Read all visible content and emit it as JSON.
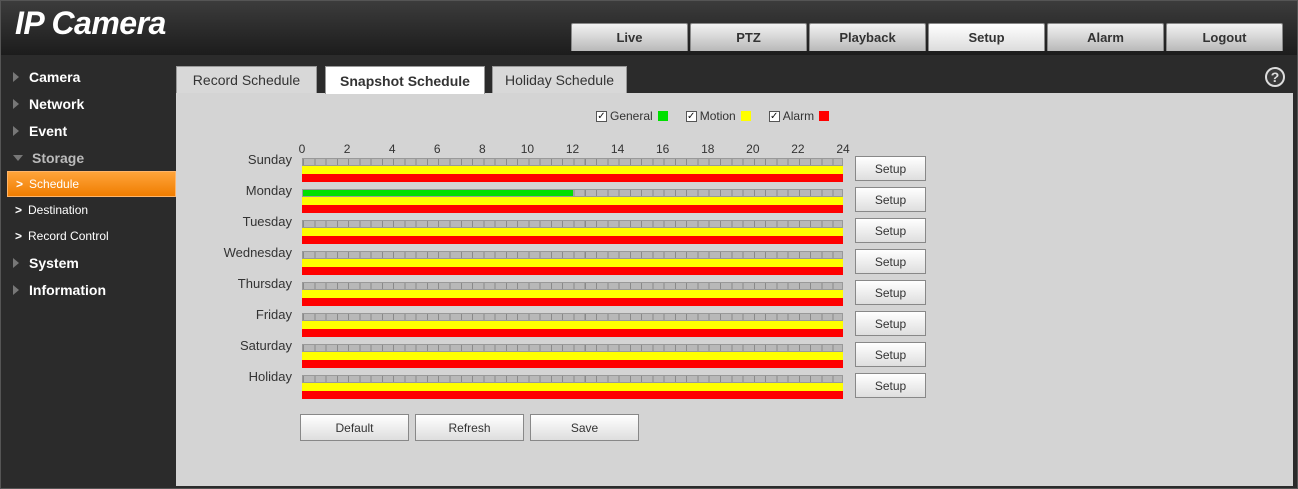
{
  "header": {
    "logo": "IP Camera",
    "nav": [
      "Live",
      "PTZ",
      "Playback",
      "Setup",
      "Alarm",
      "Logout"
    ],
    "active_nav": "Setup"
  },
  "sidebar": {
    "items": [
      {
        "label": "Camera",
        "type": "top"
      },
      {
        "label": "Network",
        "type": "top"
      },
      {
        "label": "Event",
        "type": "top"
      },
      {
        "label": "Storage",
        "type": "top",
        "open": true
      },
      {
        "label": "Schedule",
        "type": "sub",
        "active": true
      },
      {
        "label": "Destination",
        "type": "sub"
      },
      {
        "label": "Record Control",
        "type": "sub"
      },
      {
        "label": "System",
        "type": "top"
      },
      {
        "label": "Information",
        "type": "top"
      }
    ]
  },
  "tabs": [
    {
      "label": "Record Schedule"
    },
    {
      "label": "Snapshot Schedule",
      "active": true
    },
    {
      "label": "Holiday Schedule"
    }
  ],
  "legend": [
    {
      "label": "General",
      "checked": true,
      "color": "#00e000"
    },
    {
      "label": "Motion",
      "checked": true,
      "color": "#ffff00"
    },
    {
      "label": "Alarm",
      "checked": true,
      "color": "#ff0000"
    }
  ],
  "hour_ticks": [
    "0",
    "2",
    "4",
    "6",
    "8",
    "10",
    "12",
    "14",
    "16",
    "18",
    "20",
    "22",
    "24"
  ],
  "schedule": [
    {
      "day": "Sunday",
      "general_until_hour": 0
    },
    {
      "day": "Monday",
      "general_until_hour": 12
    },
    {
      "day": "Tuesday",
      "general_until_hour": 0
    },
    {
      "day": "Wednesday",
      "general_until_hour": 0
    },
    {
      "day": "Thursday",
      "general_until_hour": 0
    },
    {
      "day": "Friday",
      "general_until_hour": 0
    },
    {
      "day": "Saturday",
      "general_until_hour": 0
    },
    {
      "day": "Holiday",
      "general_until_hour": 0
    }
  ],
  "row_setup_label": "Setup",
  "buttons": {
    "default": "Default",
    "refresh": "Refresh",
    "save": "Save"
  },
  "help_symbol": "?"
}
